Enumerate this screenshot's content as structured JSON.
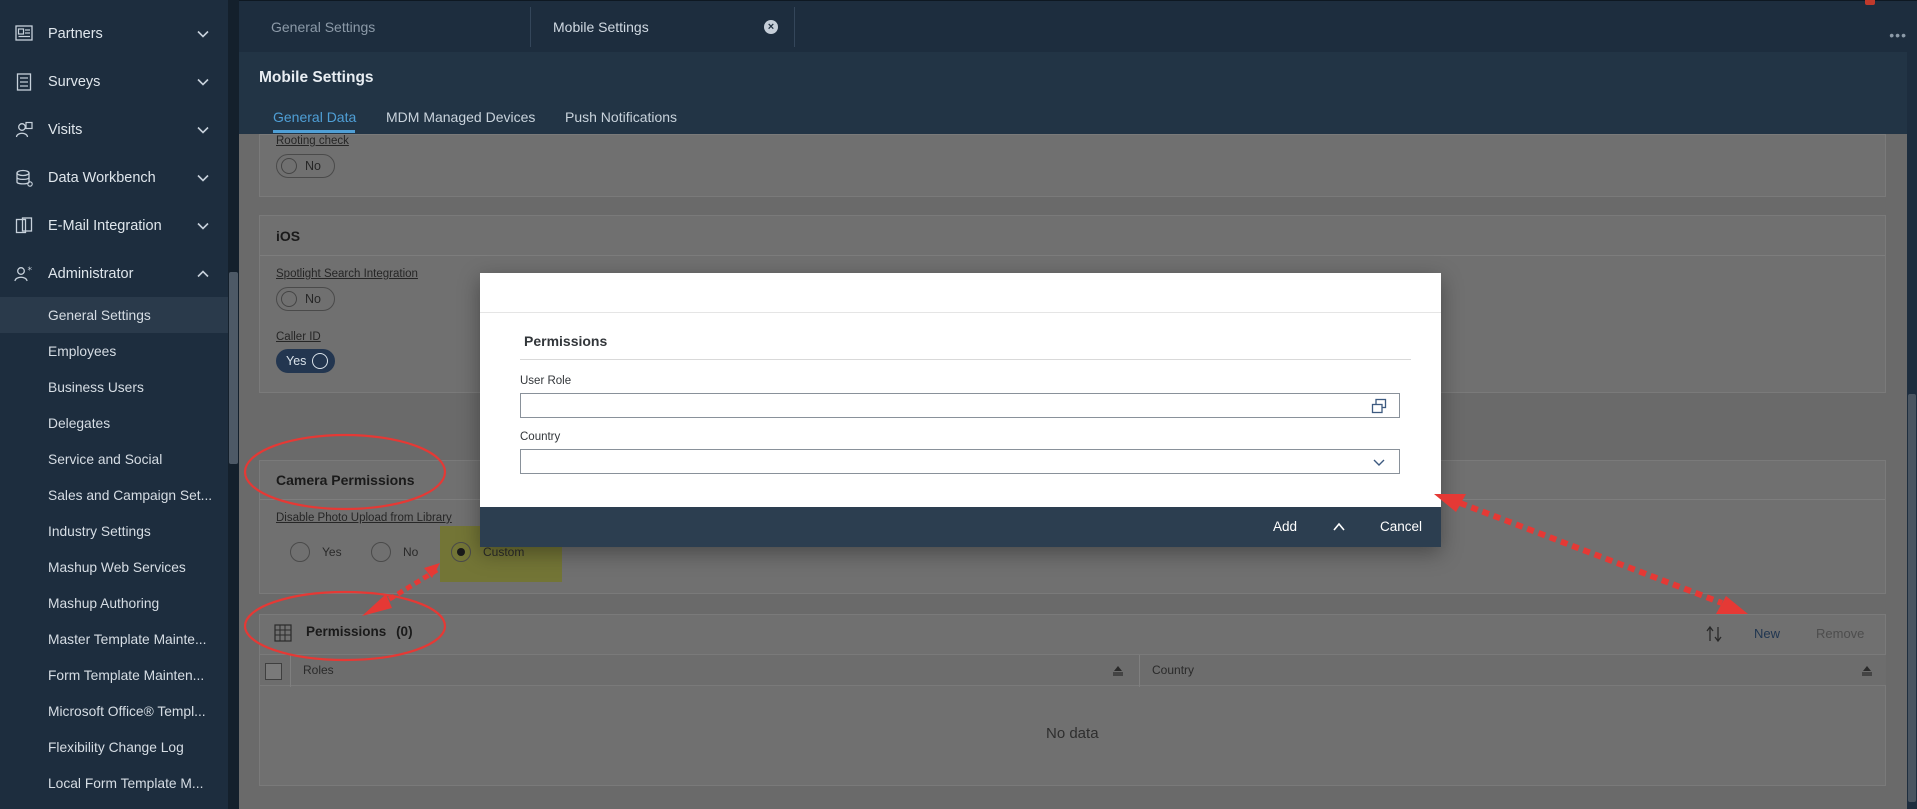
{
  "sidebar": {
    "groups": [
      {
        "label": "Partners",
        "icon": "partners-icon",
        "expanded": false
      },
      {
        "label": "Surveys",
        "icon": "surveys-icon",
        "expanded": false
      },
      {
        "label": "Visits",
        "icon": "visits-icon",
        "expanded": false
      },
      {
        "label": "Data Workbench",
        "icon": "data-workbench-icon",
        "expanded": false
      },
      {
        "label": "E-Mail Integration",
        "icon": "email-integration-icon",
        "expanded": false
      },
      {
        "label": "Administrator",
        "icon": "administrator-icon",
        "expanded": true
      }
    ],
    "sub_items": [
      {
        "label": "General Settings",
        "active": true
      },
      {
        "label": "Employees"
      },
      {
        "label": "Business Users"
      },
      {
        "label": "Delegates"
      },
      {
        "label": "Service and Social"
      },
      {
        "label": "Sales and Campaign Set..."
      },
      {
        "label": "Industry Settings"
      },
      {
        "label": "Mashup Web Services"
      },
      {
        "label": "Mashup Authoring"
      },
      {
        "label": "Master Template Mainte..."
      },
      {
        "label": "Form Template Mainten..."
      },
      {
        "label": "Microsoft Office® Templ..."
      },
      {
        "label": "Flexibility Change Log"
      },
      {
        "label": "Local Form Template M..."
      }
    ]
  },
  "shell_tabs": [
    {
      "label": "General Settings"
    },
    {
      "label": "Mobile Settings",
      "closable": true
    }
  ],
  "page": {
    "title": "Mobile Settings",
    "tabs": [
      "General Data",
      "MDM Managed Devices",
      "Push Notifications"
    ],
    "active_tab": "General Data"
  },
  "content": {
    "rooting": {
      "label": "Rooting check",
      "value": "No"
    },
    "ios": {
      "heading": "iOS",
      "spotlight": {
        "label": "Spotlight Search Integration",
        "value": "No"
      },
      "caller_id": {
        "label": "Caller ID",
        "value": "Yes"
      }
    },
    "camera": {
      "heading": "Camera Permissions",
      "field_label": "Disable Photo Upload from Library",
      "options": [
        "Yes",
        "No",
        "Custom"
      ],
      "selected": "Custom"
    },
    "permissions_table": {
      "title": "Permissions",
      "count": "(0)",
      "new_label": "New",
      "remove_label": "Remove",
      "columns": [
        "Roles",
        "Country"
      ],
      "empty_text": "No data"
    }
  },
  "dialog": {
    "section_title": "Permissions",
    "user_role_label": "User Role",
    "user_role_value": "",
    "country_label": "Country",
    "country_value": "",
    "add_label": "Add",
    "cancel_label": "Cancel"
  },
  "colors": {
    "shell": "#1d2d3e",
    "accent": "#4f9fd6",
    "annotation": "#e53935"
  }
}
